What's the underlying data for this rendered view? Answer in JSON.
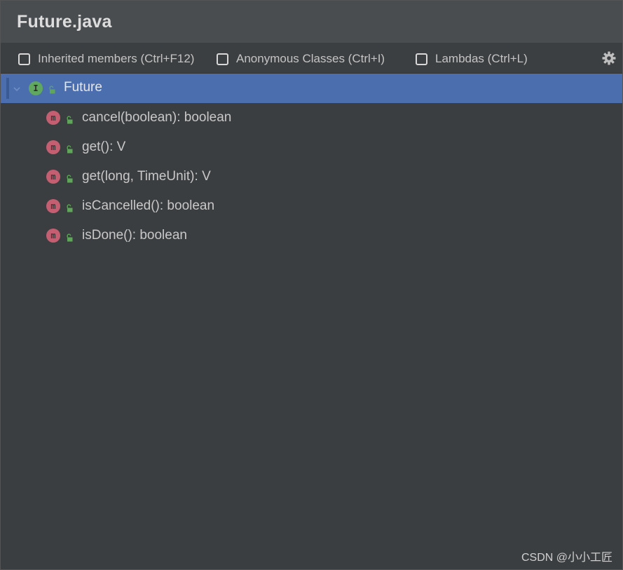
{
  "window": {
    "title": "Future.java"
  },
  "toolbar": {
    "options": [
      {
        "label": "Inherited members (Ctrl+F12)",
        "checked": false
      },
      {
        "label": "Anonymous Classes (Ctrl+I)",
        "checked": false
      },
      {
        "label": "Lambdas (Ctrl+L)",
        "checked": false
      }
    ],
    "settings_icon": "gear-icon"
  },
  "tree": {
    "root": {
      "label": "Future",
      "kind_icon_letter": "I",
      "kind": "interface",
      "expanded": true,
      "selected": true
    },
    "members": [
      {
        "label": "cancel(boolean): boolean",
        "kind_icon_letter": "m"
      },
      {
        "label": "get(): V",
        "kind_icon_letter": "m"
      },
      {
        "label": "get(long, TimeUnit): V",
        "kind_icon_letter": "m"
      },
      {
        "label": "isCancelled(): boolean",
        "kind_icon_letter": "m"
      },
      {
        "label": "isDone(): boolean",
        "kind_icon_letter": "m"
      }
    ]
  },
  "colors": {
    "selection": "#4b6eaf",
    "interface_icon": "#60a85f",
    "method_icon": "#c35f71",
    "public_lock": "#5fa55a"
  },
  "watermark": "CSDN @小小工匠"
}
